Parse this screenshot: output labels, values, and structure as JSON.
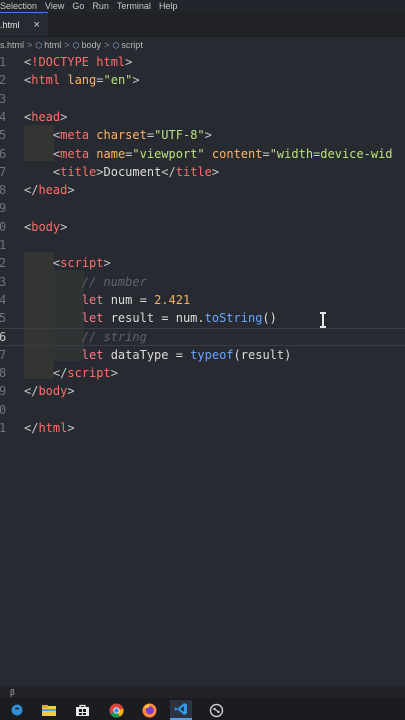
{
  "menu": {
    "items": [
      "Selection",
      "View",
      "Go",
      "Run",
      "Terminal",
      "Help"
    ]
  },
  "tab": {
    "label": ".html",
    "close": "×"
  },
  "breadcrumb": {
    "file": "s.html",
    "items": [
      "html",
      "body",
      "script"
    ],
    "separator": ">"
  },
  "editor": {
    "lines": [
      {
        "num": "1",
        "tokens": [
          [
            "t-punct",
            "<"
          ],
          [
            "t-tag",
            "!DOCTYPE html"
          ],
          [
            "t-punct",
            ">"
          ]
        ]
      },
      {
        "num": "2",
        "tokens": [
          [
            "t-punct",
            "<"
          ],
          [
            "t-tag",
            "html "
          ],
          [
            "t-attr",
            "lang"
          ],
          [
            "t-punct",
            "="
          ],
          [
            "t-str",
            "\"en\""
          ],
          [
            "t-punct",
            ">"
          ]
        ]
      },
      {
        "num": "3",
        "tokens": []
      },
      {
        "num": "4",
        "tokens": [
          [
            "t-punct",
            "<"
          ],
          [
            "t-tag",
            "head"
          ],
          [
            "t-punct",
            ">"
          ]
        ]
      },
      {
        "num": "5",
        "tokens": [
          [
            "t-plain",
            "    "
          ],
          [
            "t-punct",
            "<"
          ],
          [
            "t-tag",
            "meta "
          ],
          [
            "t-attr",
            "charset"
          ],
          [
            "t-punct",
            "="
          ],
          [
            "t-str",
            "\"UTF-8\""
          ],
          [
            "t-punct",
            ">"
          ]
        ]
      },
      {
        "num": "6",
        "tokens": [
          [
            "t-plain",
            "    "
          ],
          [
            "t-punct",
            "<"
          ],
          [
            "t-tag",
            "meta "
          ],
          [
            "t-attr",
            "name"
          ],
          [
            "t-punct",
            "="
          ],
          [
            "t-str",
            "\"viewport\" "
          ],
          [
            "t-attr",
            "content"
          ],
          [
            "t-punct",
            "="
          ],
          [
            "t-str",
            "\"width=device-wid"
          ]
        ]
      },
      {
        "num": "7",
        "tokens": [
          [
            "t-plain",
            "    "
          ],
          [
            "t-punct",
            "<"
          ],
          [
            "t-tag",
            "title"
          ],
          [
            "t-punct",
            ">"
          ],
          [
            "t-plain",
            "Document"
          ],
          [
            "t-punct",
            "</"
          ],
          [
            "t-tag",
            "title"
          ],
          [
            "t-punct",
            ">"
          ]
        ]
      },
      {
        "num": "8",
        "tokens": [
          [
            "t-punct",
            "</"
          ],
          [
            "t-tag",
            "head"
          ],
          [
            "t-punct",
            ">"
          ]
        ]
      },
      {
        "num": "9",
        "tokens": []
      },
      {
        "num": "0",
        "tokens": [
          [
            "t-punct",
            "<"
          ],
          [
            "t-tag",
            "body"
          ],
          [
            "t-punct",
            ">"
          ]
        ]
      },
      {
        "num": "1",
        "tokens": []
      },
      {
        "num": "2",
        "tokens": [
          [
            "t-plain",
            "    "
          ],
          [
            "t-punct",
            "<"
          ],
          [
            "t-tag",
            "script"
          ],
          [
            "t-punct",
            ">"
          ]
        ]
      },
      {
        "num": "3",
        "tokens": [
          [
            "t-plain",
            "        "
          ],
          [
            "t-comment",
            "// number"
          ]
        ]
      },
      {
        "num": "4",
        "tokens": [
          [
            "t-plain",
            "        "
          ],
          [
            "t-kw",
            "let "
          ],
          [
            "t-plain",
            "num = "
          ],
          [
            "t-num",
            "2.421"
          ]
        ]
      },
      {
        "num": "5",
        "tokens": [
          [
            "t-plain",
            "        "
          ],
          [
            "t-kw",
            "let "
          ],
          [
            "t-plain",
            "result = num."
          ],
          [
            "t-fn",
            "toString"
          ],
          [
            "t-plain",
            "()"
          ]
        ]
      },
      {
        "num": "6",
        "tokens": [
          [
            "t-plain",
            "        "
          ],
          [
            "t-comment",
            "// string"
          ]
        ],
        "active": true
      },
      {
        "num": "7",
        "tokens": [
          [
            "t-plain",
            "        "
          ],
          [
            "t-kw",
            "let "
          ],
          [
            "t-plain",
            "dataType = "
          ],
          [
            "t-fn",
            "typeof"
          ],
          [
            "t-plain",
            "(result)"
          ]
        ]
      },
      {
        "num": "8",
        "tokens": [
          [
            "t-plain",
            "    "
          ],
          [
            "t-punct",
            "</"
          ],
          [
            "t-tag",
            "script"
          ],
          [
            "t-punct",
            ">"
          ]
        ]
      },
      {
        "num": "9",
        "tokens": [
          [
            "t-punct",
            "</"
          ],
          [
            "t-tag",
            "body"
          ],
          [
            "t-punct",
            ">"
          ]
        ]
      },
      {
        "num": "0",
        "tokens": []
      },
      {
        "num": "1",
        "tokens": [
          [
            "t-punct",
            "</"
          ],
          [
            "t-tag",
            "html"
          ],
          [
            "t-punct",
            ">"
          ]
        ]
      }
    ]
  },
  "taskbar": {
    "icons": [
      {
        "name": "edge-icon",
        "color": "#2f8fd8"
      },
      {
        "name": "file-explorer-icon",
        "color": "#f2c94c"
      },
      {
        "name": "store-icon",
        "color": "#e8e8e8"
      },
      {
        "name": "chrome-icon",
        "color": "#db4437"
      },
      {
        "name": "firefox-icon",
        "color": "#ff8a3d"
      },
      {
        "name": "vscode-icon",
        "color": "#2f9be8"
      },
      {
        "name": "github-desktop-icon",
        "color": "#cfcfcf"
      }
    ]
  }
}
